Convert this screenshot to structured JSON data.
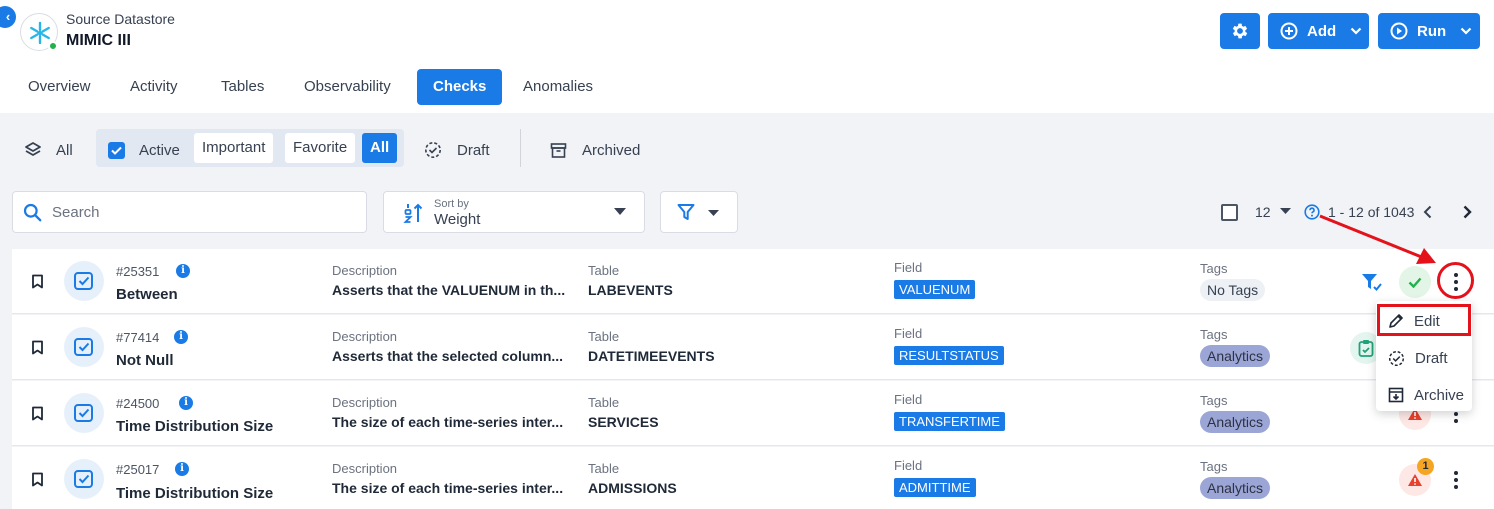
{
  "header": {
    "datastore_type": "Source Datastore",
    "datastore_name": "MIMIC III",
    "add_label": "Add",
    "run_label": "Run"
  },
  "tabs": [
    {
      "label": "Overview",
      "active": false
    },
    {
      "label": "Activity",
      "active": false
    },
    {
      "label": "Tables",
      "active": false
    },
    {
      "label": "Observability",
      "active": false
    },
    {
      "label": "Checks",
      "active": true
    },
    {
      "label": "Anomalies",
      "active": false
    }
  ],
  "filters": {
    "all_label": "All",
    "active_label": "Active",
    "important_label": "Important",
    "favorite_label": "Favorite",
    "all_chip_label": "All",
    "draft_label": "Draft",
    "archived_label": "Archived"
  },
  "toolbar": {
    "search_placeholder": "Search",
    "sort_caption": "Sort by",
    "sort_value": "Weight",
    "per_page": "12",
    "page_range": "1 - 12 of 1043"
  },
  "checks": [
    {
      "id": "#25351",
      "name": "Between",
      "description_caption": "Description",
      "description": "Asserts that the VALUENUM in th...",
      "table_caption": "Table",
      "table": "LABEVENTS",
      "field_caption": "Field",
      "field": "VALUENUM",
      "tags_caption": "Tags",
      "tag": "No Tags",
      "tag_style": "none"
    },
    {
      "id": "#77414",
      "name": "Not Null",
      "description_caption": "Description",
      "description": "Asserts that the selected column...",
      "table_caption": "Table",
      "table": "DATETIMEEVENTS",
      "field_caption": "Field",
      "field": "RESULTSTATUS",
      "tags_caption": "Tags",
      "tag": "Analytics",
      "tag_style": "analytics"
    },
    {
      "id": "#24500",
      "name": "Time Distribution Size",
      "description_caption": "Description",
      "description": "The size of each time-series inter...",
      "table_caption": "Table",
      "table": "SERVICES",
      "field_caption": "Field",
      "field": "TRANSFERTIME",
      "tags_caption": "Tags",
      "tag": "Analytics",
      "tag_style": "analytics"
    },
    {
      "id": "#25017",
      "name": "Time Distribution Size",
      "description_caption": "Description",
      "description": "The size of each time-series inter...",
      "table_caption": "Table",
      "table": "ADMISSIONS",
      "field_caption": "Field",
      "field": "ADMITTIME",
      "tags_caption": "Tags",
      "tag": "Analytics",
      "tag_style": "analytics",
      "anomaly_count": "1"
    }
  ],
  "menu": {
    "edit_label": "Edit",
    "draft_label": "Draft",
    "archive_label": "Archive"
  },
  "colors": {
    "primary": "#1a7be6",
    "annotation_red": "#e3121b",
    "success_green": "#22b14c",
    "warning_red": "#e8412c",
    "tag_analytics": "#9ba6d6"
  },
  "icons": [
    "back-icon",
    "snowflake-icon",
    "gear-icon",
    "plus-circle-icon",
    "play-circle-icon",
    "layers-icon",
    "checkbox-icon",
    "draft-icon",
    "archive-box-icon",
    "search-icon",
    "sort-icon",
    "filter-icon",
    "help-icon",
    "bookmark-icon",
    "check-square-icon",
    "info-icon",
    "kebab-icon",
    "pencil-icon",
    "archive-icon"
  ]
}
